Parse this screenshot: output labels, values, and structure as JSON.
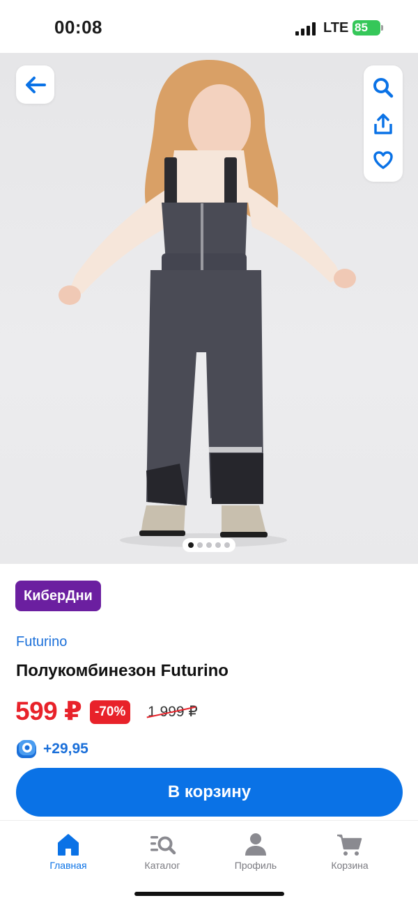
{
  "status_bar": {
    "time": "00:08",
    "network": "LTE",
    "battery": "85"
  },
  "gallery": {
    "image_alt": "Полукомбинезон Futurino",
    "slide_count": 5,
    "active_slide": 1
  },
  "icons": {
    "back": "arrow-left-icon",
    "search": "search-icon",
    "share": "share-icon",
    "favorite": "heart-icon",
    "bonus": "bonus-coin-icon"
  },
  "product": {
    "promo_badge": "КиберДни",
    "brand": "Futurino",
    "title": "Полукомбинезон Futurino",
    "price": "599 ₽",
    "discount": "-70%",
    "old_price": "1 999 ₽",
    "bonus": "+29,95"
  },
  "cart_button": {
    "label": "В корзину"
  },
  "tabbar": {
    "items": [
      {
        "label": "Главная",
        "icon": "home-icon",
        "active": true
      },
      {
        "label": "Каталог",
        "icon": "catalog-icon",
        "active": false
      },
      {
        "label": "Профиль",
        "icon": "profile-icon",
        "active": false
      },
      {
        "label": "Корзина",
        "icon": "cart-icon",
        "active": false
      }
    ]
  },
  "colors": {
    "accent": "#0a72e6",
    "price": "#e8222a",
    "promo": "#6b1fa0"
  }
}
